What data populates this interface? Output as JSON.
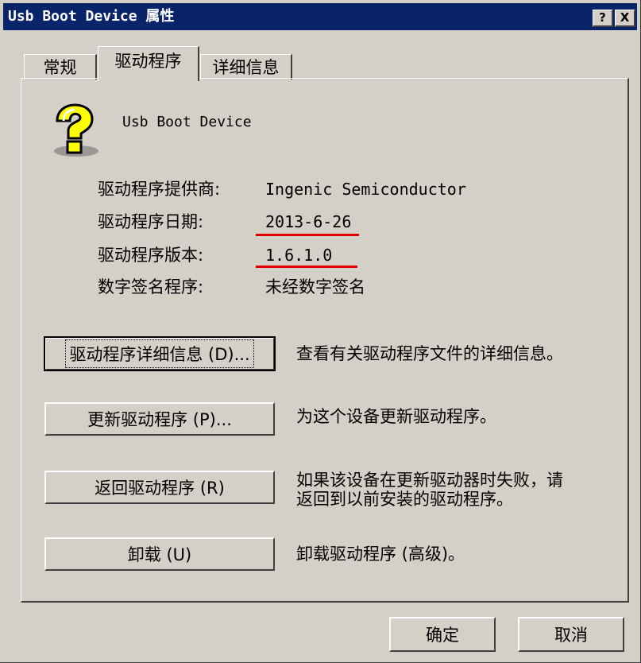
{
  "window": {
    "title": "Usb Boot Device 属性",
    "help_label": "?",
    "close_label": "X"
  },
  "tabs": [
    {
      "label": "常规",
      "active": false
    },
    {
      "label": "驱动程序",
      "active": true
    },
    {
      "label": "详细信息",
      "active": false
    }
  ],
  "device": {
    "name": "Usb Boot Device",
    "icon": "unknown-device-question-icon"
  },
  "info": [
    {
      "label": "驱动程序提供商:",
      "value": "Ingenic Semiconductor"
    },
    {
      "label": "驱动程序日期:",
      "value": "2013-6-26"
    },
    {
      "label": "驱动程序版本:",
      "value": "1.6.1.0"
    },
    {
      "label": "数字签名程序:",
      "value": "未经数字签名"
    }
  ],
  "actions": [
    {
      "button": "驱动程序详细信息 (D)...",
      "description": "查看有关驱动程序文件的详细信息。"
    },
    {
      "button": "更新驱动程序 (P)...",
      "description": "为这个设备更新驱动程序。"
    },
    {
      "button": "返回驱动程序 (R)",
      "description_line1": "如果该设备在更新驱动器时失败，请",
      "description_line2": "返回到以前安装的驱动程序。"
    },
    {
      "button": "卸载 (U)",
      "description": "卸载驱动程序 (高级)。"
    }
  ],
  "footer": {
    "ok_label": "确定",
    "cancel_label": "取消"
  },
  "colors": {
    "titlebar": "#0a246a",
    "face": "#d4d0c8",
    "annotation": "#e00000",
    "icon_yellow": "#ffff00"
  }
}
